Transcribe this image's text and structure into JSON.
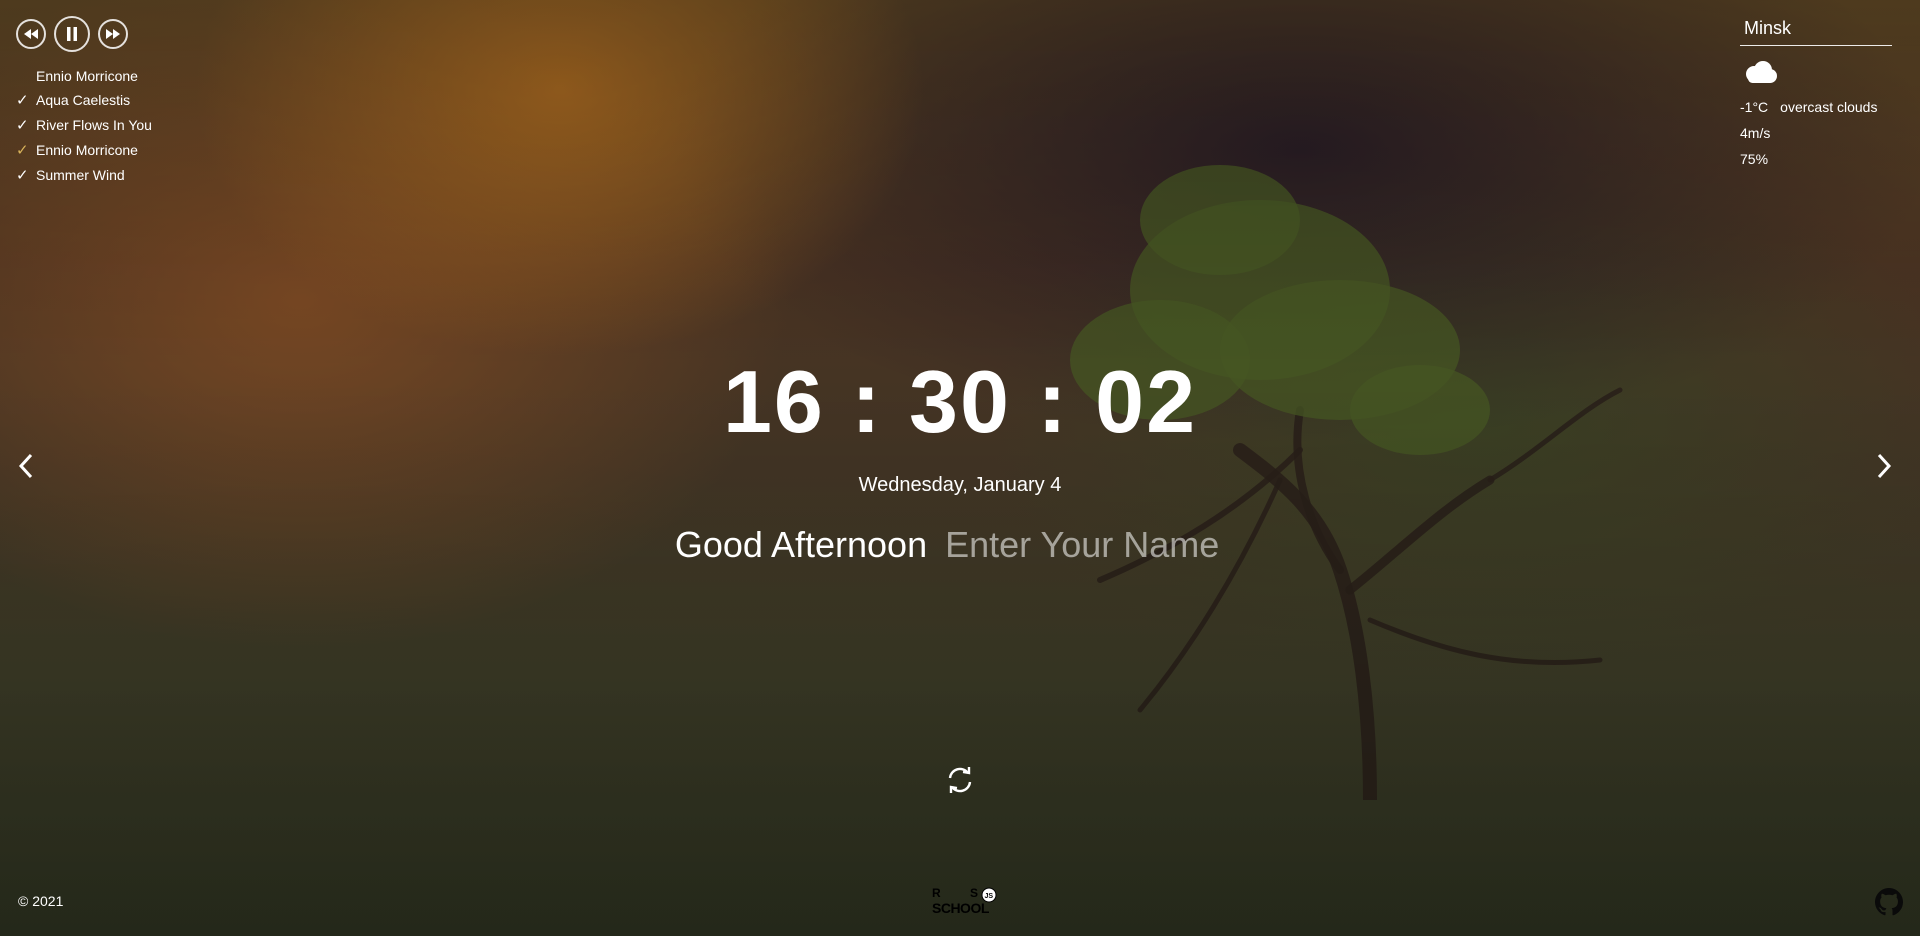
{
  "player": {
    "controls": [
      "play-prev-icon",
      "pause-icon",
      "play-next-icon"
    ],
    "now_playing": "Ennio Morricone",
    "playlist": [
      {
        "title": "Aqua Caelestis",
        "active": false
      },
      {
        "title": "River Flows In You",
        "active": false
      },
      {
        "title": "Ennio Morricone",
        "active": true
      },
      {
        "title": "Summer Wind",
        "active": false
      }
    ],
    "check_glyph": "✓",
    "active_color": "#d7b25a"
  },
  "weather": {
    "city": "Minsk",
    "icon": "overcast-clouds-icon",
    "temperature": "-1°C",
    "description": "overcast clouds",
    "wind": "4m/s",
    "humidity": "75%"
  },
  "clock": {
    "time": "16 : 30 : 02",
    "date": "Wednesday, January 4"
  },
  "greeting": {
    "text": "Good Afternoon",
    "name_placeholder": "Enter Your Name",
    "name_value": ""
  },
  "slider": {
    "prev_icon": "chevron-left-icon",
    "next_icon": "chevron-right-icon"
  },
  "quote": {
    "change_icon": "refresh-icon"
  },
  "footer": {
    "copyright": "© 2021",
    "logo_text": "RS SCHOOL",
    "github_icon": "github-icon"
  }
}
